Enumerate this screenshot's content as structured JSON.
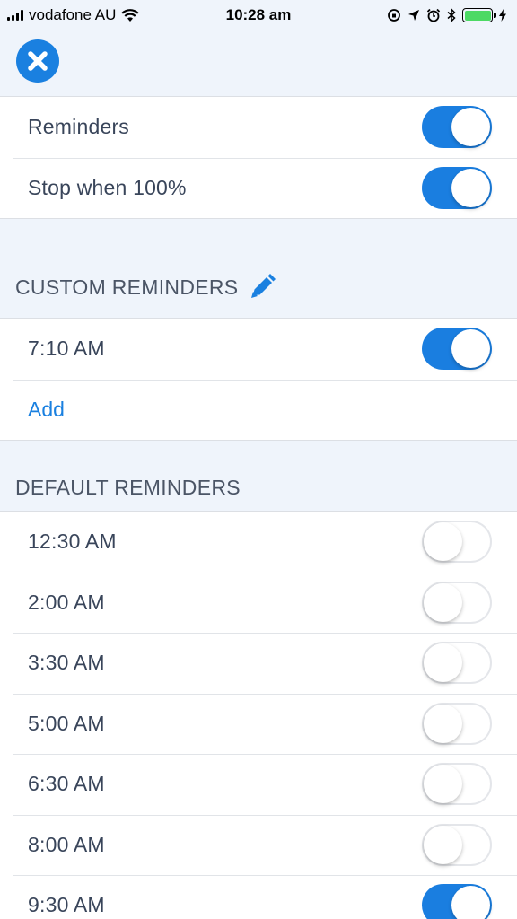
{
  "status_bar": {
    "carrier": "vodafone AU",
    "time": "10:28 am"
  },
  "toggles": {
    "reminders_label": "Reminders",
    "reminders_on": true,
    "stop_label": "Stop when 100%",
    "stop_on": true
  },
  "custom": {
    "header": "CUSTOM REMINDERS",
    "items": [
      {
        "time": "7:10 AM",
        "on": true
      }
    ],
    "add_label": "Add"
  },
  "default": {
    "header": "DEFAULT REMINDERS",
    "items": [
      {
        "time": "12:30 AM",
        "on": false
      },
      {
        "time": "2:00 AM",
        "on": false
      },
      {
        "time": "3:30 AM",
        "on": false
      },
      {
        "time": "5:00 AM",
        "on": false
      },
      {
        "time": "6:30 AM",
        "on": false
      },
      {
        "time": "8:00 AM",
        "on": false
      },
      {
        "time": "9:30 AM",
        "on": true
      }
    ]
  },
  "colors": {
    "accent": "#1a80e0",
    "background": "#eff4fb",
    "battery": "#4cd964"
  }
}
